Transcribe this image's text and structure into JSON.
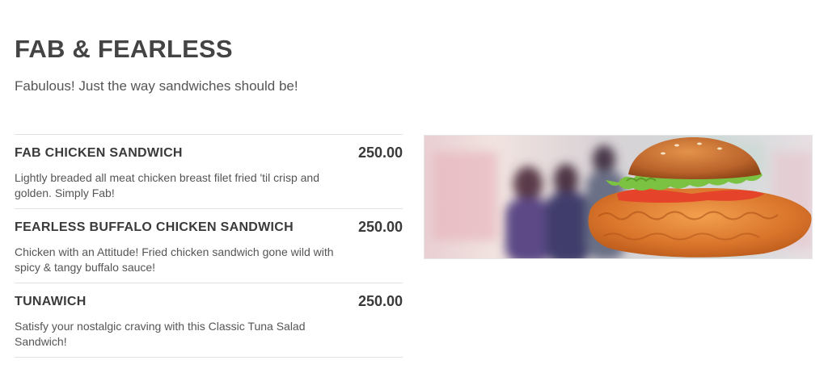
{
  "section": {
    "title": "FAB & FEARLESS",
    "subtitle": "Fabulous! Just the way sandwiches should be!"
  },
  "items": [
    {
      "name": "FAB CHICKEN SANDWICH",
      "price": "250.00",
      "description": "Lightly breaded all meat chicken breast filet fried 'til crisp and golden. Simply Fab!"
    },
    {
      "name": "FEARLESS BUFFALO CHICKEN SANDWICH",
      "price": "250.00",
      "description": "Chicken with an Attitude! Fried chicken sandwich gone wild with spicy & tangy buffalo sauce!"
    },
    {
      "name": "TUNAWICH",
      "price": "250.00",
      "description": "Satisfy your nostalgic craving with this Classic Tuna Salad Sandwich!"
    }
  ],
  "colors": {
    "text": "#3d3d3d",
    "divider": "#e3e3e3",
    "bun": "#c8722a",
    "lettuce": "#7cc242",
    "tomato": "#e5432a",
    "chicken": "#d9742b"
  }
}
